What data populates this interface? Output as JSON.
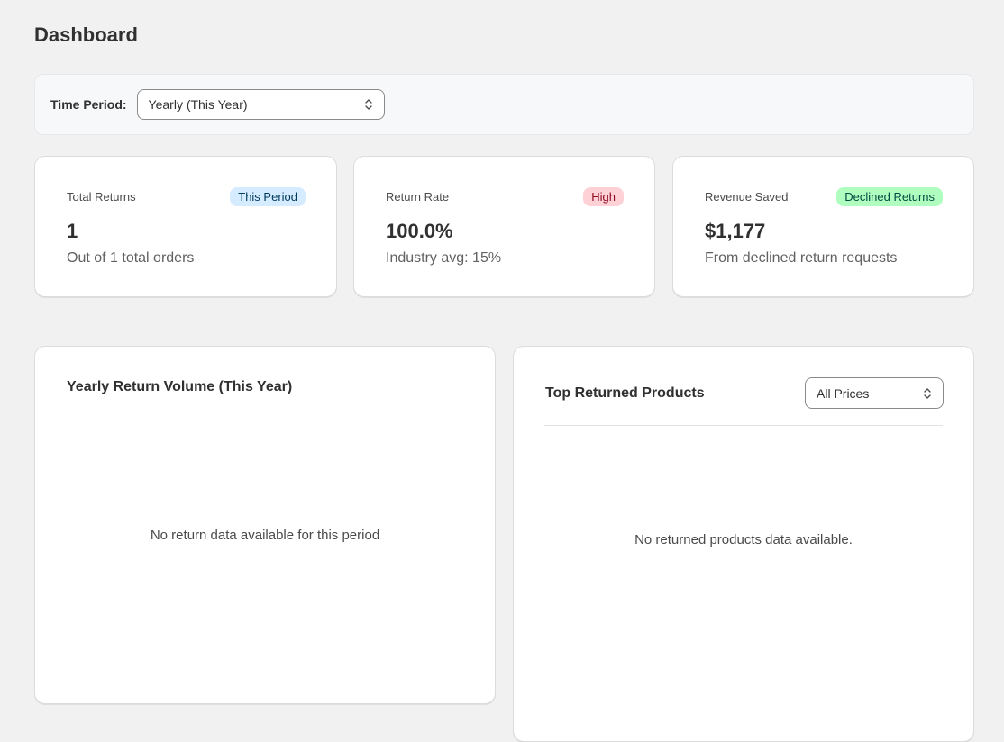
{
  "page": {
    "title": "Dashboard"
  },
  "filters": {
    "time_period_label": "Time Period:",
    "time_period_value": "Yearly (This Year)"
  },
  "stats": [
    {
      "label": "Total Returns",
      "badge": "This Period",
      "badge_bg": "#d5ebff",
      "badge_color": "#003a5a",
      "value": "1",
      "sub": "Out of 1 total orders"
    },
    {
      "label": "Return Rate",
      "badge": "High",
      "badge_bg": "#fed1d7",
      "badge_color": "#8e0b21",
      "value": "100.0%",
      "sub": "Industry avg: 15%"
    },
    {
      "label": "Revenue Saved",
      "badge": "Declined Returns",
      "badge_bg": "#affebf",
      "badge_color": "#014b40",
      "value": "$1,177",
      "sub": "From declined return requests"
    }
  ],
  "volume_panel": {
    "title": "Yearly Return Volume (This Year)",
    "empty_message": "No return data available for this period"
  },
  "products_panel": {
    "title": "Top Returned Products",
    "price_filter_value": "All Prices",
    "empty_message": "No returned products data available."
  },
  "icons": {
    "select_chevron": "chevron-up-down-icon"
  }
}
